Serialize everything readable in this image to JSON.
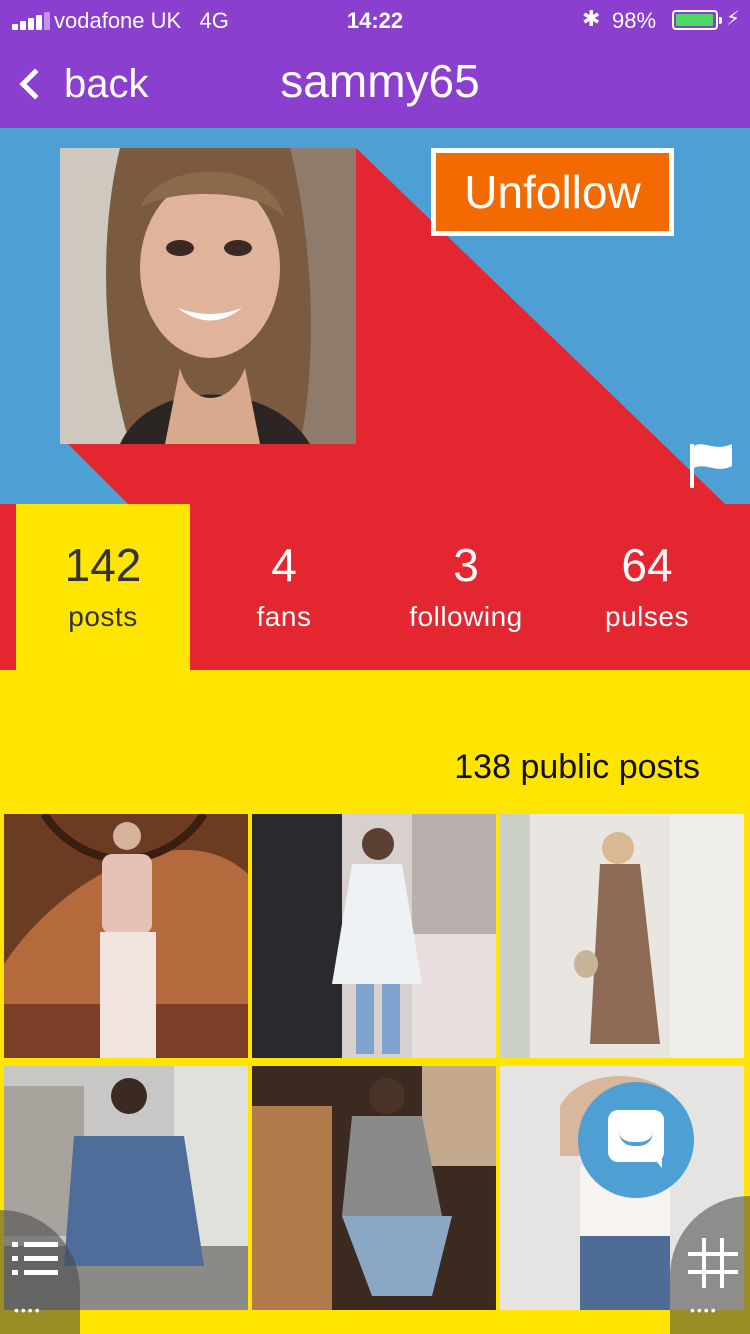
{
  "status_bar": {
    "carrier": "vodafone UK",
    "network": "4G",
    "time": "14:22",
    "bluetooth_icon": "bluetooth-icon",
    "battery_percent": "98%",
    "battery_level": 0.98,
    "battery_color": "#4cd964"
  },
  "nav": {
    "back_label": "back",
    "title": "sammy65"
  },
  "profile": {
    "unfollow_label": "Unfollow",
    "flag_icon": "flag-icon"
  },
  "stats": [
    {
      "value": "142",
      "label": "posts"
    },
    {
      "value": "4",
      "label": "fans"
    },
    {
      "value": "3",
      "label": "following"
    },
    {
      "value": "64",
      "label": "pulses"
    }
  ],
  "posts": {
    "public_count_label": "138 public posts"
  },
  "colors": {
    "nav_purple": "#8a3fcf",
    "hero_blue": "#4e9fd4",
    "stats_red": "#e3262f",
    "accent_yellow": "#ffe500",
    "button_orange": "#f26a00"
  }
}
